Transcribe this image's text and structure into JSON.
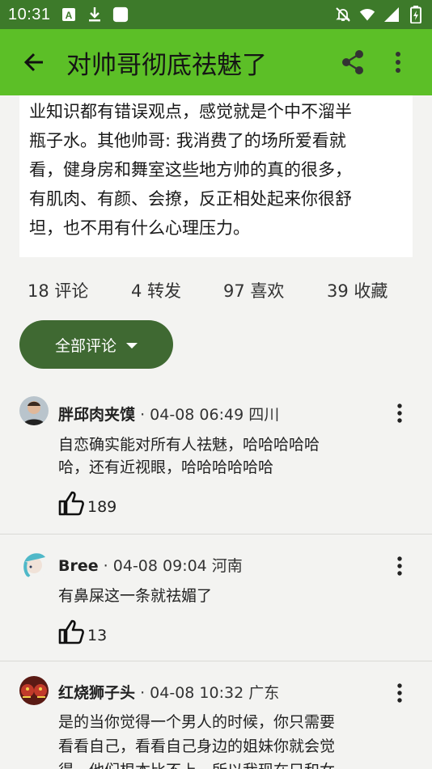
{
  "status_bar": {
    "time": "10:31",
    "icons": [
      "a-badge-icon",
      "download-icon",
      "square-icon",
      "mute-bell-icon",
      "wifi-icon",
      "signal-icon",
      "battery-icon"
    ]
  },
  "app_bar": {
    "title": "对帅哥彻底祛魅了",
    "back_icon": "arrow-left-icon",
    "share_icon": "share-icon",
    "more_icon": "more-vertical-icon"
  },
  "post": {
    "text": "业知识都有错误观点，感觉就是个中不溜半\n瓶子水。其他帅哥: 我消费了的场所爱看就\n看，健身房和舞室这些地方帅的真的很多，\n有肌肉、有颜、会撩，反正相处起来你很舒\n坦，也不用有什么心理压力。"
  },
  "stats": {
    "comments": "18 评论",
    "reposts": "4 转发",
    "likes": "97 喜欢",
    "favorites": "39 收藏"
  },
  "filter": {
    "label": "全部评论"
  },
  "comments": [
    {
      "name": "胖邱肉夹馍",
      "meta": "04-08 06:49 四川",
      "body": "自恋确实能对所有人祛魅，哈哈哈哈哈\n哈，还有近视眼，哈哈哈哈哈哈",
      "likes": "189"
    },
    {
      "name": "Bree",
      "meta": "04-08 09:04 河南",
      "body": "有鼻屎这一条就祛媚了",
      "likes": "13"
    },
    {
      "name": "红烧狮子头",
      "meta": "04-08 10:32 广东",
      "body": "是的当你觉得一个男人的时候，你只需要\n看看自己，看看自己身边的姐妹你就会觉\n得，他们根本比不上，所以我现在只和女",
      "likes": ""
    }
  ],
  "colors": {
    "status_bar": "#3d7a2a",
    "app_bar": "#5cbf27",
    "filter_button": "#3f6932",
    "background": "#f3f3f1"
  }
}
